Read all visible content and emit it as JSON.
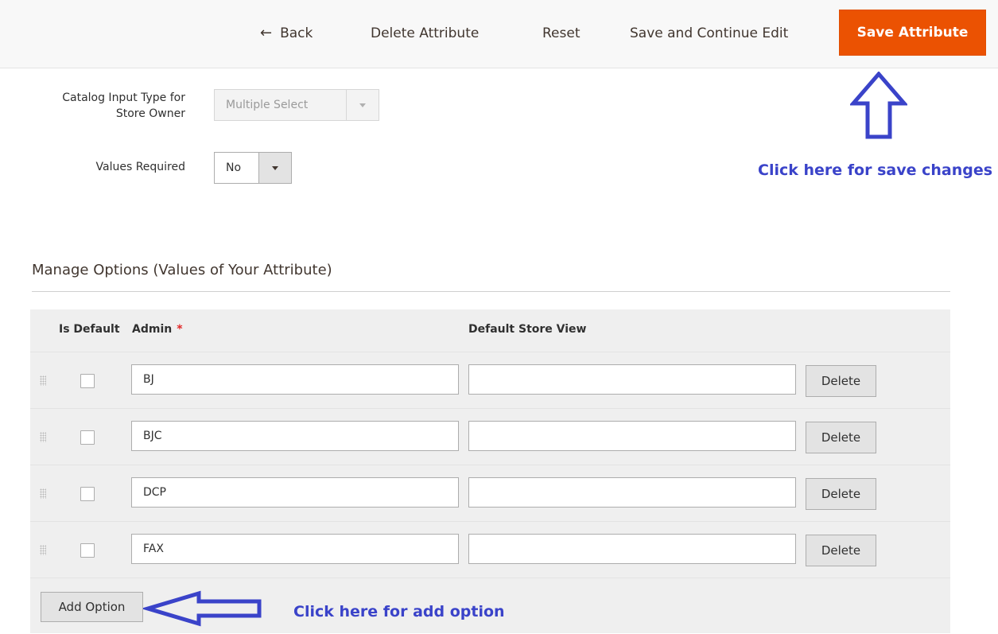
{
  "toolbar": {
    "back_icon": "←",
    "back_label": "Back",
    "delete_label": "Delete Attribute",
    "reset_label": "Reset",
    "save_continue_label": "Save and Continue Edit",
    "save_label": "Save Attribute",
    "save_color": "#eb5202"
  },
  "form": {
    "input_type": {
      "label": "Catalog Input Type for Store Owner",
      "value": "Multiple Select",
      "disabled": true
    },
    "values_required": {
      "label": "Values Required",
      "value": "No"
    }
  },
  "manage_options": {
    "title": "Manage Options (Values of Your Attribute)",
    "columns": {
      "is_default": "Is Default",
      "admin": "Admin",
      "admin_required_mark": "*",
      "store_view": "Default Store View"
    },
    "rows": [
      {
        "admin": "BJ",
        "store_view": "",
        "delete_label": "Delete"
      },
      {
        "admin": "BJC",
        "store_view": "",
        "delete_label": "Delete"
      },
      {
        "admin": "DCP",
        "store_view": "",
        "delete_label": "Delete"
      },
      {
        "admin": "FAX",
        "store_view": "",
        "delete_label": "Delete"
      }
    ],
    "add_option_label": "Add Option"
  },
  "annotations": {
    "save_hint": "Click here for save changes",
    "add_hint": "Click here for add option",
    "color": "#3a43c9",
    "icons": [
      "up-arrow-outline-icon",
      "left-arrow-outline-icon"
    ]
  }
}
